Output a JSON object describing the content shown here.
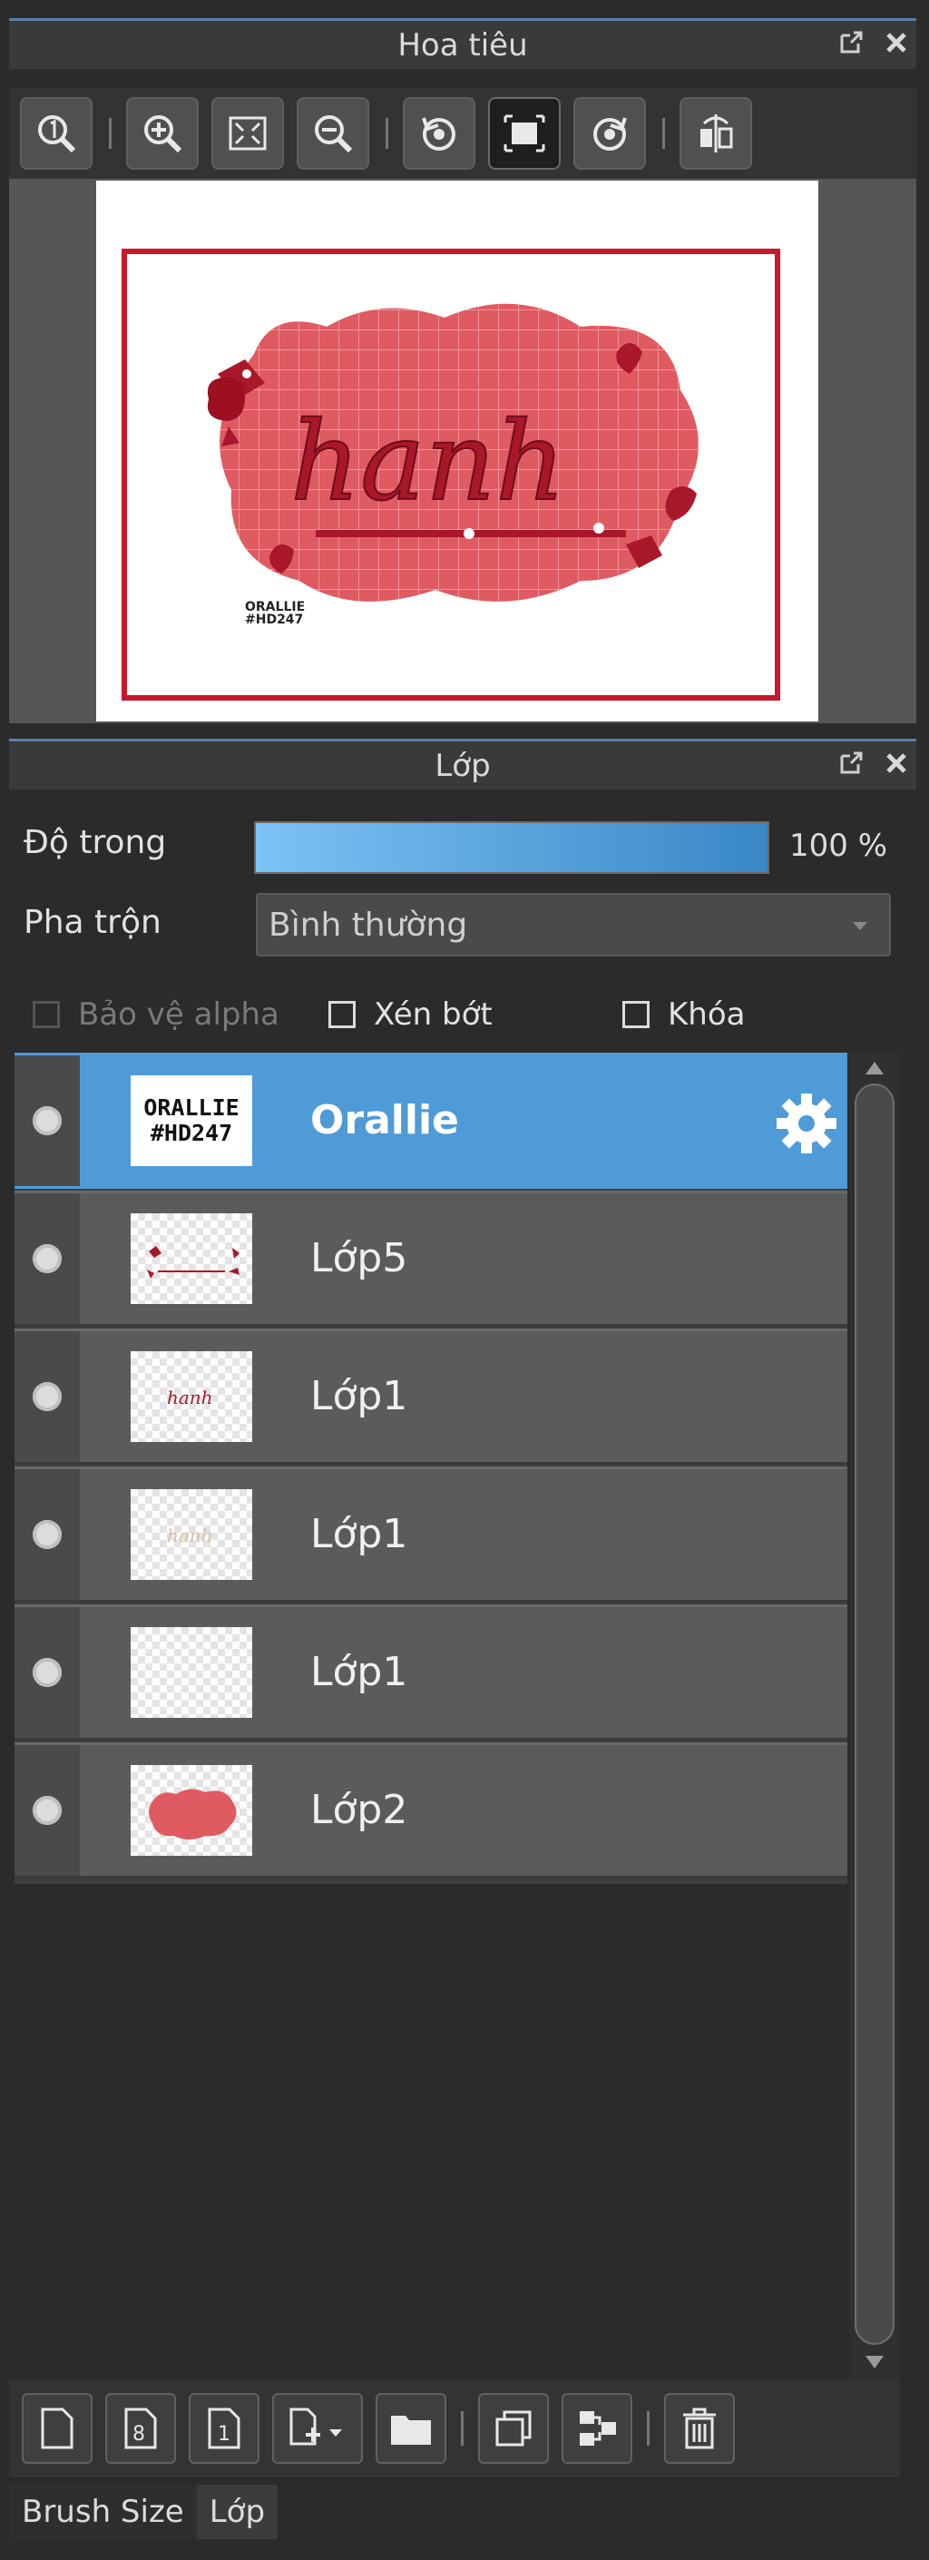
{
  "navigator": {
    "title": "Hoa tiêu",
    "canvas_text": "hanh",
    "watermark_line1": "ORALLIE",
    "watermark_line2": "#HD247"
  },
  "layers_panel": {
    "title": "Lớp",
    "opacity_label": "Độ trong",
    "opacity_value": "100 %",
    "opacity_fraction": 1.0,
    "blend_label": "Pha trộn",
    "blend_value": "Bình thường",
    "checks": {
      "alpha": "Bảo vệ alpha",
      "clip": "Xén bớt",
      "lock": "Khóa"
    },
    "layers": [
      {
        "name": "Orallie",
        "thumb": "text",
        "thumb_text1": "ORALLIE",
        "thumb_text2": "#HD247",
        "selected": true
      },
      {
        "name": "Lớp5",
        "thumb": "decor"
      },
      {
        "name": "Lớp1",
        "thumb": "script-red"
      },
      {
        "name": "Lớp1",
        "thumb": "script-beige"
      },
      {
        "name": "Lớp1",
        "thumb": "empty"
      },
      {
        "name": "Lớp2",
        "thumb": "blob"
      }
    ]
  },
  "tabs": [
    "Brush Size",
    "Lớp"
  ],
  "colors": {
    "selected": "#4f9bd8",
    "frame": "#c8182a",
    "blob": "#e05a62"
  }
}
